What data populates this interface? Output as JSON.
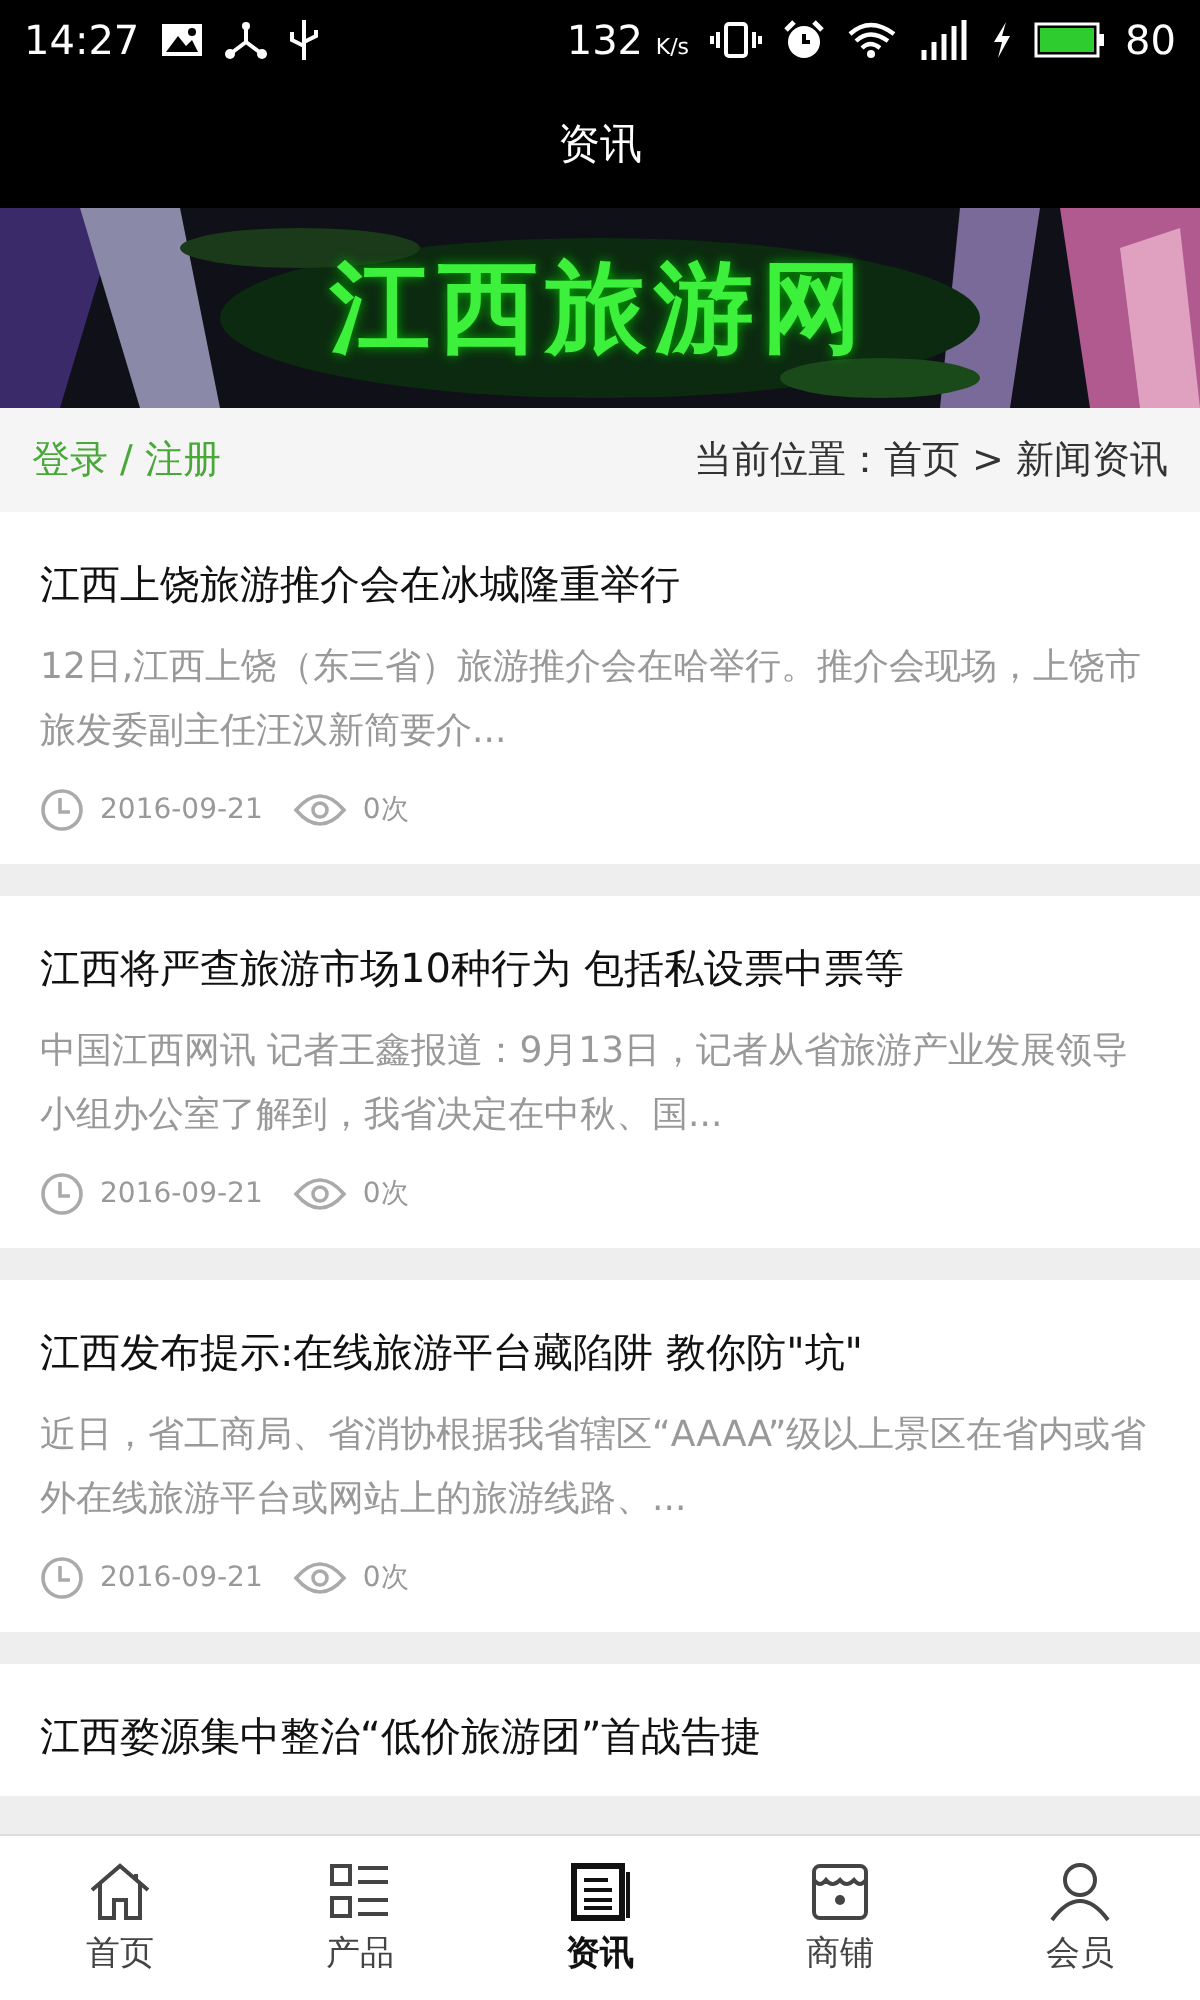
{
  "status_bar": {
    "time": "14:27",
    "speed": "132",
    "speed_unit": "K/s",
    "battery": "80"
  },
  "header": {
    "title": "资讯"
  },
  "banner": {
    "title": "江西旅游网"
  },
  "breadcrumb": {
    "login": "登录 / 注册",
    "location": "当前位置：首页 > 新闻资讯"
  },
  "articles": [
    {
      "title": "江西上饶旅游推介会在冰城隆重举行",
      "summary": " 12日,江西上饶（东三省）旅游推介会在哈举行。推介会现场，上饶市旅发委副主任汪汉新简要介...",
      "date": "2016-09-21",
      "views": "0次"
    },
    {
      "title": "江西将严查旅游市场10种行为 包括私设票中票等",
      "summary": "中国江西网讯 记者王鑫报道：9月13日，记者从省旅游产业发展领导小组办公室了解到，我省决定在中秋、国...",
      "date": "2016-09-21",
      "views": "0次"
    },
    {
      "title": "江西发布提示:在线旅游平台藏陷阱 教你防\"坑\"",
      "summary": "近日，省工商局、省消协根据我省辖区“AAAA”级以上景区在省内或省外在线旅游平台或网站上的旅游线路、...",
      "date": "2016-09-21",
      "views": "0次"
    },
    {
      "title": "江西婺源集中整治“低价旅游团”首战告捷"
    }
  ],
  "tab_bar": [
    {
      "label": "首页",
      "kind": "home",
      "selected": false
    },
    {
      "label": "产品",
      "kind": "list",
      "selected": false
    },
    {
      "label": "资讯",
      "kind": "news",
      "selected": true
    },
    {
      "label": "商铺",
      "kind": "shop",
      "selected": false
    },
    {
      "label": "会员",
      "kind": "user",
      "selected": false
    }
  ]
}
